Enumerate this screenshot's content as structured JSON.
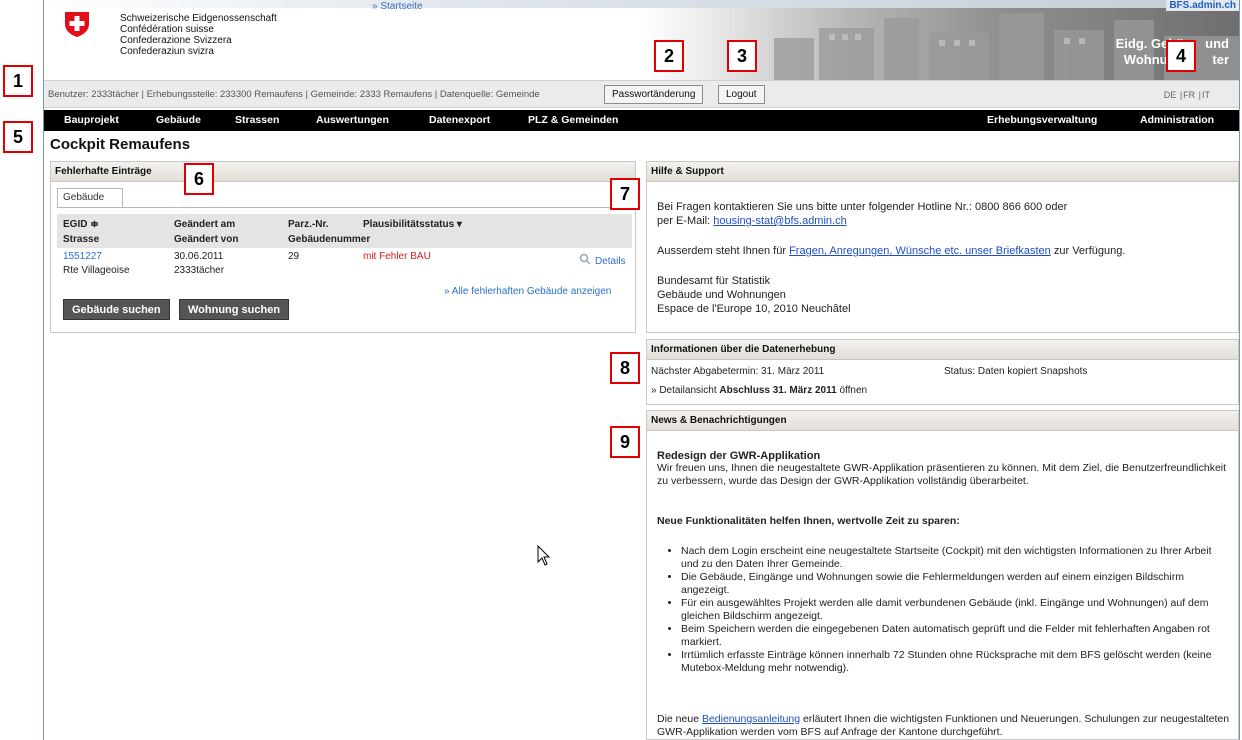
{
  "header": {
    "confederation_names": [
      "Schweizerische Eidgenossenschaft",
      "Confédération suisse",
      "Confederazione Svizzera",
      "Confederaziun svizra"
    ],
    "startseite_link": "» Startseite",
    "bfs_link": "BFS.admin.ch",
    "banner_title_line1": "Eidg. Gebä      und",
    "banner_title_line2": "Wohnungs      ter"
  },
  "userbar": {
    "info": "Benutzer: 2333tächer | Erhebungsstelle: 233300 Remaufens | Gemeinde: 2333 Remaufens | Datenquelle: Gemeinde",
    "password_button": "Passwortänderung",
    "logout_button": "Logout",
    "languages": [
      "DE",
      "FR",
      "IT"
    ]
  },
  "nav": {
    "items": [
      "Bauprojekt",
      "Gebäude",
      "Strassen",
      "Auswertungen",
      "Datenexport",
      "PLZ & Gemeinden"
    ],
    "right_items": [
      "Erhebungsverwaltung",
      "Administration"
    ]
  },
  "page_title": "Cockpit Remaufens",
  "fehlerhafte": {
    "title": "Fehlerhafte Einträge",
    "tab": "Gebäude",
    "columns": {
      "egid": "EGID ≑",
      "strasse": "Strasse",
      "geaendert_am": "Geändert am",
      "geaendert_von": "Geändert von",
      "parz": "Parz.-Nr.",
      "gebnr": "Gebäudenummer",
      "status": "Plausibilitätsstatus ▾"
    },
    "row": {
      "egid": "1551227",
      "strasse": "Rte Villageoise",
      "date": "30.06.2011",
      "user": "2333tächer",
      "parz": "29",
      "status": "mit Fehler BAU",
      "details": "Details"
    },
    "all_link": "» Alle fehlerhaften Gebäude anzeigen",
    "search_building_button": "Gebäude suchen",
    "search_flat_button": "Wohnung suchen"
  },
  "hilfe": {
    "title": "Hilfe & Support",
    "line1": "Bei Fragen kontaktieren Sie uns bitte unter folgender Hotline Nr.: 0800 866 600 oder",
    "email_prefix": "per E-Mail: ",
    "email": "housing-stat@bfs.admin.ch",
    "line2_prefix": "Ausserdem steht Ihnen für ",
    "line2_link": "Fragen, Anregungen, Wünsche etc. unser Briefkasten",
    "line2_suffix": " zur Verfügung.",
    "address": [
      "Bundesamt für Statistik",
      "Gebäude und Wohnungen",
      "Espace de l'Europe 10, 2010 Neuchâtel"
    ]
  },
  "info": {
    "title": "Informationen über die Datenerhebung",
    "next_deadline": "Nächster Abgabetermin: 31. März 2011",
    "status": "Status: Daten kopiert Snapshots",
    "detail_prefix": "» Detailansicht ",
    "detail_bold": "Abschluss 31. März 2011",
    "detail_suffix": " öffnen"
  },
  "news": {
    "title": "News & Benachrichtigungen",
    "heading": "Redesign der GWR-Applikation",
    "intro": "Wir freuen uns, Ihnen die neugestaltete GWR-Applikation präsentieren zu können. Mit dem Ziel, die Benutzerfreundlichkeit zu verbessern, wurde das Design der GWR-Applikation vollständig überarbeitet.",
    "subheading": "Neue Funktionalitäten helfen Ihnen, wertvolle Zeit zu sparen:",
    "bullets": [
      "Nach dem Login erscheint eine neugestaltete Startseite (Cockpit) mit den wichtigsten Informationen zu Ihrer Arbeit und zu den Daten Ihrer Gemeinde.",
      "Die Gebäude, Eingänge und Wohnungen sowie die Fehlermeldungen werden auf einem einzigen Bildschirm angezeigt.",
      "Für ein ausgewähltes Projekt werden alle damit verbundenen Gebäude (inkl. Eingänge und Wohnungen) auf dem gleichen Bildschirm angezeigt.",
      "Beim Speichern werden die eingegebenen Daten automatisch geprüft und die Felder mit fehlerhaften Angaben rot markiert.",
      "Irrtümlich erfasste Einträge können innerhalb 72 Stunden ohne Rücksprache mit dem BFS gelöscht werden (keine Mutebox-Meldung mehr notwendig)."
    ],
    "footer_prefix": "Die neue ",
    "footer_link": "Bedienungsanleitung",
    "footer_suffix": " erläutert Ihnen die wichtigsten Funktionen und Neuerungen. Schulungen zur neugestalteten GWR-Applikation werden vom BFS auf Anfrage der Kantone durchgeführt."
  },
  "markers": [
    "1",
    "2",
    "3",
    "4",
    "5",
    "6",
    "7",
    "8",
    "9"
  ]
}
